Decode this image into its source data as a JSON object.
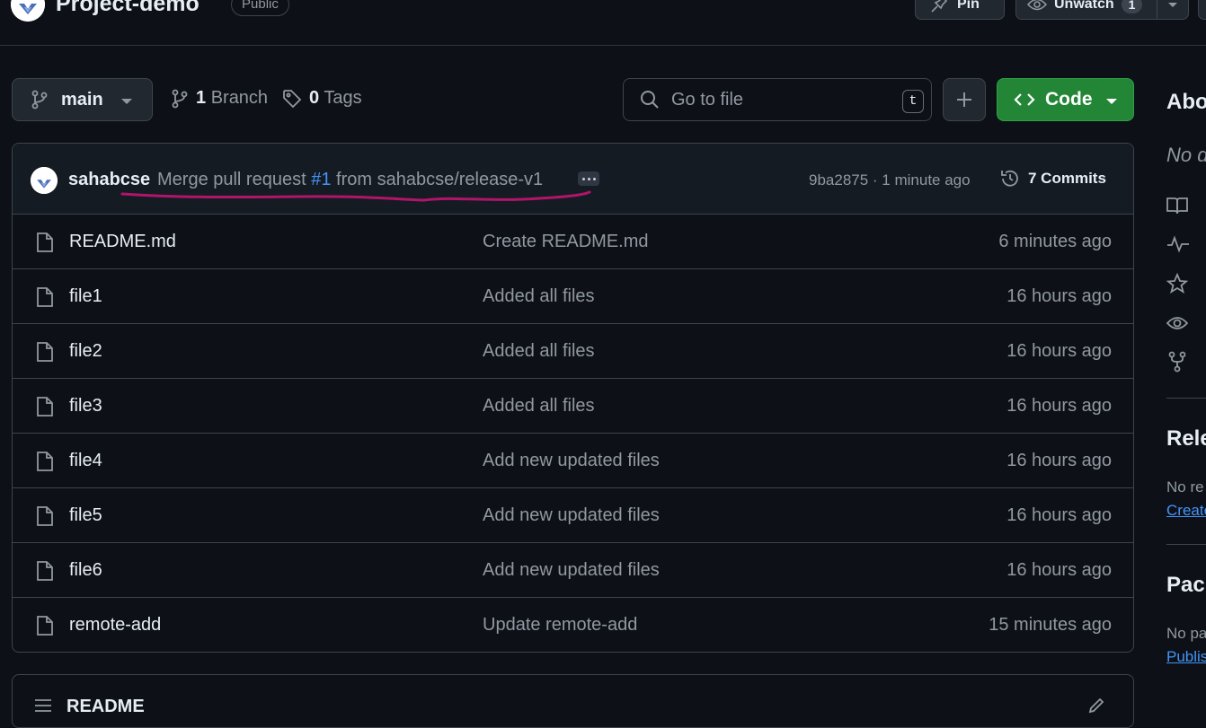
{
  "header": {
    "repo_name": "Project-demo",
    "visibility": "Public",
    "pin_label": "Pin",
    "watch_label": "Unwatch",
    "watch_count": "1"
  },
  "toolbar": {
    "branch": "main",
    "branch_count": "1",
    "branch_label": "Branch",
    "tag_count": "0",
    "tag_label": "Tags",
    "search_placeholder": "Go to file",
    "search_shortcut": "t",
    "code_label": "Code"
  },
  "latest_commit": {
    "author": "sahabcse",
    "message_prefix": "Merge pull request",
    "pr_ref": "#1",
    "message_suffix": "from sahabcse/release-v1",
    "meta": "9ba2875 · 1 minute ago",
    "commits_label": "7 Commits"
  },
  "files": [
    {
      "name": "README.md",
      "message": "Create README.md",
      "time": "6 minutes ago"
    },
    {
      "name": "file1",
      "message": "Added all files",
      "time": "16 hours ago"
    },
    {
      "name": "file2",
      "message": "Added all files",
      "time": "16 hours ago"
    },
    {
      "name": "file3",
      "message": "Added all files",
      "time": "16 hours ago"
    },
    {
      "name": "file4",
      "message": "Add new updated files",
      "time": "16 hours ago"
    },
    {
      "name": "file5",
      "message": "Add new updated files",
      "time": "16 hours ago"
    },
    {
      "name": "file6",
      "message": "Add new updated files",
      "time": "16 hours ago"
    },
    {
      "name": "remote-add",
      "message": "Update remote-add",
      "time": "15 minutes ago"
    }
  ],
  "readme": {
    "title": "README"
  },
  "sidebar": {
    "about_heading": "Abo",
    "about_text": "No d",
    "releases_heading": "Rele",
    "releases_text": "No re",
    "releases_link": "Create",
    "packages_heading": "Pack",
    "packages_text": "No pa",
    "packages_link": "Publis",
    "icons": [
      "book-icon",
      "pulse-icon",
      "star-icon",
      "eye-icon",
      "fork-icon"
    ]
  },
  "colors": {
    "background": "#0d1117",
    "border": "#3d444d",
    "code_button": "#238636",
    "link": "#4493f8",
    "annotation": "#b0156b"
  }
}
